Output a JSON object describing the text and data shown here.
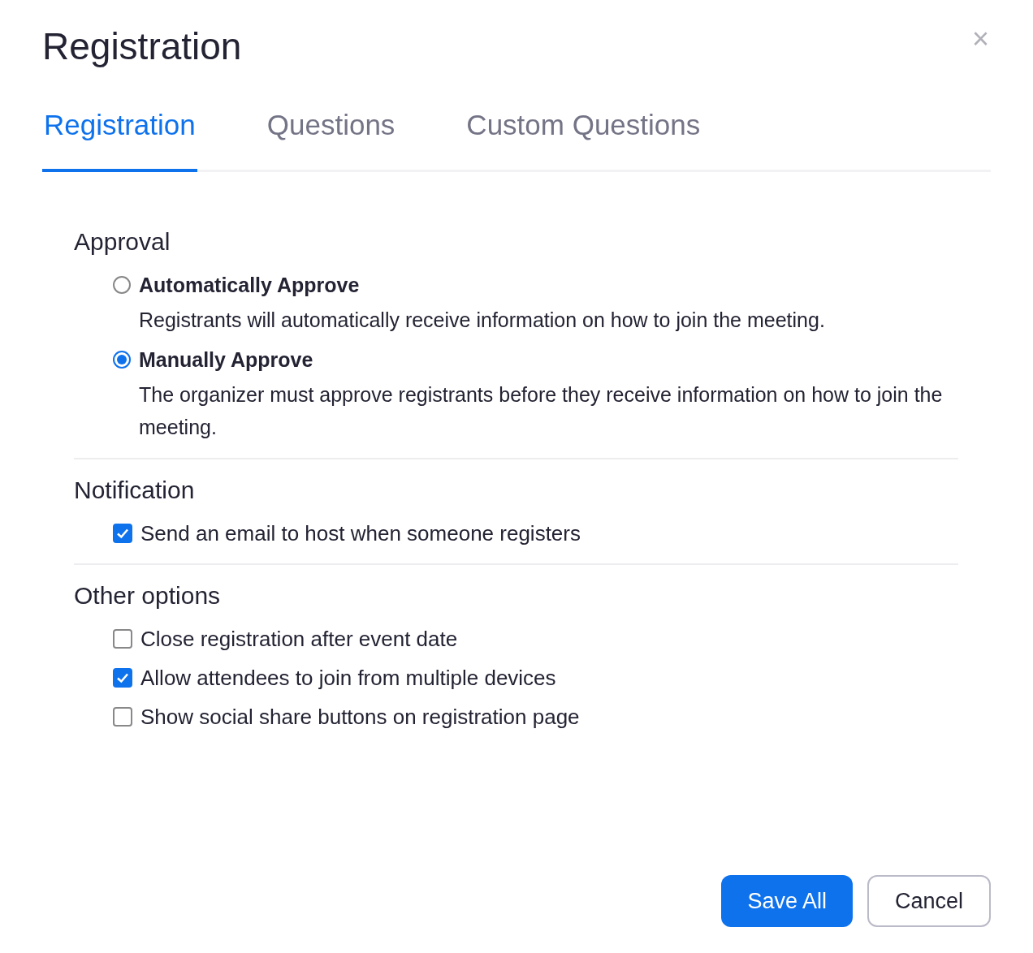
{
  "dialog": {
    "title": "Registration",
    "close": "×"
  },
  "tabs": [
    {
      "label": "Registration",
      "selected": true
    },
    {
      "label": "Questions",
      "selected": false
    },
    {
      "label": "Custom Questions",
      "selected": false
    }
  ],
  "sections": [
    {
      "heading": "Approval",
      "kind": "radio",
      "options": [
        {
          "label": "Automatically Approve",
          "description": "Registrants will automatically receive information on how to join the meeting.",
          "selected": false
        },
        {
          "label": "Manually Approve",
          "description": "The organizer must approve registrants before they receive information on how to join the meeting.",
          "selected": true
        }
      ]
    },
    {
      "heading": "Notification",
      "kind": "checkbox",
      "options": [
        {
          "label": "Send an email to host when someone registers",
          "checked": true
        }
      ]
    },
    {
      "heading": "Other options",
      "kind": "checkbox",
      "options": [
        {
          "label": "Close registration after event date",
          "checked": false
        },
        {
          "label": "Allow attendees to join from multiple devices",
          "checked": true
        },
        {
          "label": "Show social share buttons on registration page",
          "checked": false
        }
      ]
    }
  ],
  "buttons": [
    {
      "label": "Save All",
      "kind": "primary"
    },
    {
      "label": "Cancel",
      "kind": "secondary"
    }
  ]
}
